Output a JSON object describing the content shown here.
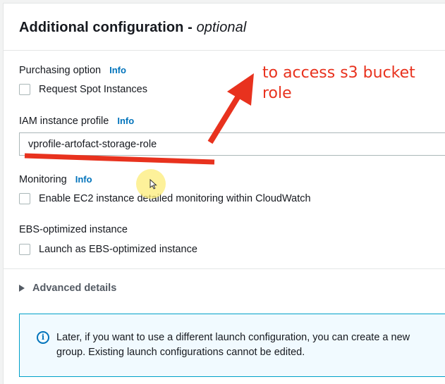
{
  "section": {
    "title": "Additional configuration",
    "title_separator": " - ",
    "title_suffix": "optional"
  },
  "purchasing": {
    "label": "Purchasing option",
    "info": "Info",
    "checkbox_label": "Request Spot Instances",
    "checked": false
  },
  "iam": {
    "label": "IAM instance profile",
    "info": "Info",
    "value": "vprofile-artofact-storage-role"
  },
  "monitoring": {
    "label": "Monitoring",
    "info": "Info",
    "checkbox_label": "Enable EC2 instance detailed monitoring within CloudWatch",
    "checked": false
  },
  "ebs": {
    "label": "EBS-optimized instance",
    "checkbox_label": "Launch as EBS-optimized instance",
    "checked": false
  },
  "advanced": {
    "label": "Advanced details"
  },
  "info_alert": {
    "icon": "info-circle-icon",
    "line1": "Later, if you want to use a different launch configuration, you can create a new",
    "line2": "group. Existing launch configurations cannot be edited."
  },
  "annotation": {
    "line1": "to access s3 bucket",
    "line2": "role",
    "color": "#e8321e"
  },
  "colors": {
    "link": "#0073bb",
    "alert_border": "#00a1c9",
    "alert_bg": "#f1faff"
  }
}
